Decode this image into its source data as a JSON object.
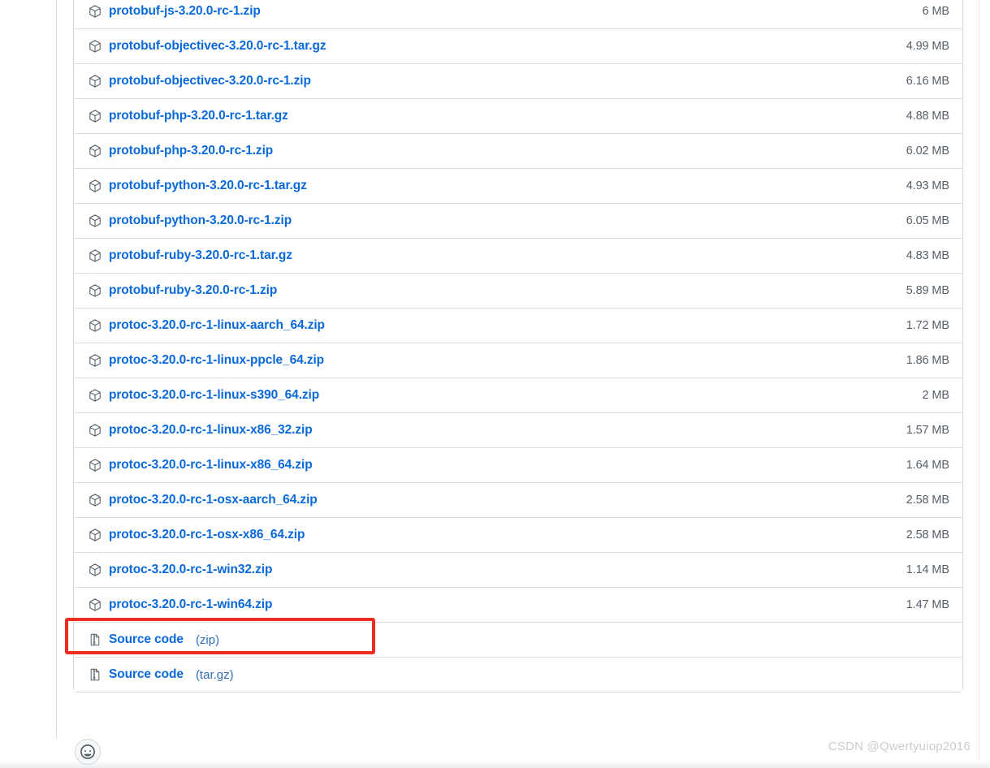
{
  "page": {
    "watermark": "CSDN @Qwertyuiop2016",
    "link_color": "#0969da",
    "size_color": "#57606a",
    "border_color": "#d0d7de",
    "divider_color": "#d8dee4",
    "highlight_color": "#ef2c21"
  },
  "reaction": {
    "icon": "smiley-icon",
    "label": ""
  },
  "assets": {
    "icon_package": "package-icon",
    "icon_file_zip": "file-zip-icon",
    "rows": [
      {
        "name": "protobuf-js-3.20.0-rc-1.zip",
        "suffix": "",
        "size": "6 MB",
        "icon": "package-icon",
        "highlighted": false
      },
      {
        "name": "protobuf-objectivec-3.20.0-rc-1.tar.gz",
        "suffix": "",
        "size": "4.99 MB",
        "icon": "package-icon",
        "highlighted": false
      },
      {
        "name": "protobuf-objectivec-3.20.0-rc-1.zip",
        "suffix": "",
        "size": "6.16 MB",
        "icon": "package-icon",
        "highlighted": false
      },
      {
        "name": "protobuf-php-3.20.0-rc-1.tar.gz",
        "suffix": "",
        "size": "4.88 MB",
        "icon": "package-icon",
        "highlighted": false
      },
      {
        "name": "protobuf-php-3.20.0-rc-1.zip",
        "suffix": "",
        "size": "6.02 MB",
        "icon": "package-icon",
        "highlighted": false
      },
      {
        "name": "protobuf-python-3.20.0-rc-1.tar.gz",
        "suffix": "",
        "size": "4.93 MB",
        "icon": "package-icon",
        "highlighted": false
      },
      {
        "name": "protobuf-python-3.20.0-rc-1.zip",
        "suffix": "",
        "size": "6.05 MB",
        "icon": "package-icon",
        "highlighted": false
      },
      {
        "name": "protobuf-ruby-3.20.0-rc-1.tar.gz",
        "suffix": "",
        "size": "4.83 MB",
        "icon": "package-icon",
        "highlighted": false
      },
      {
        "name": "protobuf-ruby-3.20.0-rc-1.zip",
        "suffix": "",
        "size": "5.89 MB",
        "icon": "package-icon",
        "highlighted": false
      },
      {
        "name": "protoc-3.20.0-rc-1-linux-aarch_64.zip",
        "suffix": "",
        "size": "1.72 MB",
        "icon": "package-icon",
        "highlighted": false
      },
      {
        "name": "protoc-3.20.0-rc-1-linux-ppcle_64.zip",
        "suffix": "",
        "size": "1.86 MB",
        "icon": "package-icon",
        "highlighted": false
      },
      {
        "name": "protoc-3.20.0-rc-1-linux-s390_64.zip",
        "suffix": "",
        "size": "2 MB",
        "icon": "package-icon",
        "highlighted": false
      },
      {
        "name": "protoc-3.20.0-rc-1-linux-x86_32.zip",
        "suffix": "",
        "size": "1.57 MB",
        "icon": "package-icon",
        "highlighted": false
      },
      {
        "name": "protoc-3.20.0-rc-1-linux-x86_64.zip",
        "suffix": "",
        "size": "1.64 MB",
        "icon": "package-icon",
        "highlighted": false
      },
      {
        "name": "protoc-3.20.0-rc-1-osx-aarch_64.zip",
        "suffix": "",
        "size": "2.58 MB",
        "icon": "package-icon",
        "highlighted": false
      },
      {
        "name": "protoc-3.20.0-rc-1-osx-x86_64.zip",
        "suffix": "",
        "size": "2.58 MB",
        "icon": "package-icon",
        "highlighted": false
      },
      {
        "name": "protoc-3.20.0-rc-1-win32.zip",
        "suffix": "",
        "size": "1.14 MB",
        "icon": "package-icon",
        "highlighted": false
      },
      {
        "name": "protoc-3.20.0-rc-1-win64.zip",
        "suffix": "",
        "size": "1.47 MB",
        "icon": "package-icon",
        "highlighted": true
      },
      {
        "name": "Source code",
        "suffix": "(zip)",
        "size": "",
        "icon": "file-zip-icon",
        "highlighted": false
      },
      {
        "name": "Source code",
        "suffix": "(tar.gz)",
        "size": "",
        "icon": "file-zip-icon",
        "highlighted": false
      }
    ]
  }
}
